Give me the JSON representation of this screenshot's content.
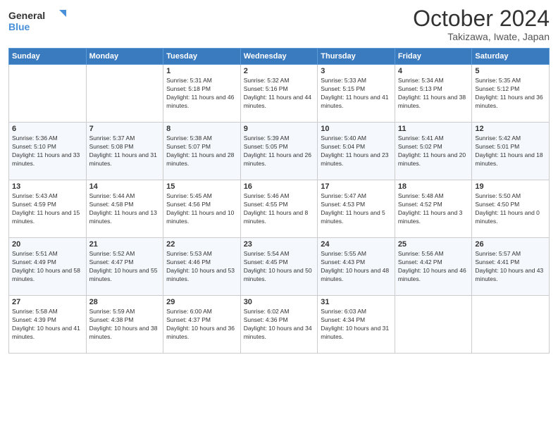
{
  "header": {
    "logo_line1": "General",
    "logo_line2": "Blue",
    "month": "October 2024",
    "location": "Takizawa, Iwate, Japan"
  },
  "weekdays": [
    "Sunday",
    "Monday",
    "Tuesday",
    "Wednesday",
    "Thursday",
    "Friday",
    "Saturday"
  ],
  "weeks": [
    [
      {
        "day": "",
        "sunrise": "",
        "sunset": "",
        "daylight": ""
      },
      {
        "day": "",
        "sunrise": "",
        "sunset": "",
        "daylight": ""
      },
      {
        "day": "1",
        "sunrise": "Sunrise: 5:31 AM",
        "sunset": "Sunset: 5:18 PM",
        "daylight": "Daylight: 11 hours and 46 minutes."
      },
      {
        "day": "2",
        "sunrise": "Sunrise: 5:32 AM",
        "sunset": "Sunset: 5:16 PM",
        "daylight": "Daylight: 11 hours and 44 minutes."
      },
      {
        "day": "3",
        "sunrise": "Sunrise: 5:33 AM",
        "sunset": "Sunset: 5:15 PM",
        "daylight": "Daylight: 11 hours and 41 minutes."
      },
      {
        "day": "4",
        "sunrise": "Sunrise: 5:34 AM",
        "sunset": "Sunset: 5:13 PM",
        "daylight": "Daylight: 11 hours and 38 minutes."
      },
      {
        "day": "5",
        "sunrise": "Sunrise: 5:35 AM",
        "sunset": "Sunset: 5:12 PM",
        "daylight": "Daylight: 11 hours and 36 minutes."
      }
    ],
    [
      {
        "day": "6",
        "sunrise": "Sunrise: 5:36 AM",
        "sunset": "Sunset: 5:10 PM",
        "daylight": "Daylight: 11 hours and 33 minutes."
      },
      {
        "day": "7",
        "sunrise": "Sunrise: 5:37 AM",
        "sunset": "Sunset: 5:08 PM",
        "daylight": "Daylight: 11 hours and 31 minutes."
      },
      {
        "day": "8",
        "sunrise": "Sunrise: 5:38 AM",
        "sunset": "Sunset: 5:07 PM",
        "daylight": "Daylight: 11 hours and 28 minutes."
      },
      {
        "day": "9",
        "sunrise": "Sunrise: 5:39 AM",
        "sunset": "Sunset: 5:05 PM",
        "daylight": "Daylight: 11 hours and 26 minutes."
      },
      {
        "day": "10",
        "sunrise": "Sunrise: 5:40 AM",
        "sunset": "Sunset: 5:04 PM",
        "daylight": "Daylight: 11 hours and 23 minutes."
      },
      {
        "day": "11",
        "sunrise": "Sunrise: 5:41 AM",
        "sunset": "Sunset: 5:02 PM",
        "daylight": "Daylight: 11 hours and 20 minutes."
      },
      {
        "day": "12",
        "sunrise": "Sunrise: 5:42 AM",
        "sunset": "Sunset: 5:01 PM",
        "daylight": "Daylight: 11 hours and 18 minutes."
      }
    ],
    [
      {
        "day": "13",
        "sunrise": "Sunrise: 5:43 AM",
        "sunset": "Sunset: 4:59 PM",
        "daylight": "Daylight: 11 hours and 15 minutes."
      },
      {
        "day": "14",
        "sunrise": "Sunrise: 5:44 AM",
        "sunset": "Sunset: 4:58 PM",
        "daylight": "Daylight: 11 hours and 13 minutes."
      },
      {
        "day": "15",
        "sunrise": "Sunrise: 5:45 AM",
        "sunset": "Sunset: 4:56 PM",
        "daylight": "Daylight: 11 hours and 10 minutes."
      },
      {
        "day": "16",
        "sunrise": "Sunrise: 5:46 AM",
        "sunset": "Sunset: 4:55 PM",
        "daylight": "Daylight: 11 hours and 8 minutes."
      },
      {
        "day": "17",
        "sunrise": "Sunrise: 5:47 AM",
        "sunset": "Sunset: 4:53 PM",
        "daylight": "Daylight: 11 hours and 5 minutes."
      },
      {
        "day": "18",
        "sunrise": "Sunrise: 5:48 AM",
        "sunset": "Sunset: 4:52 PM",
        "daylight": "Daylight: 11 hours and 3 minutes."
      },
      {
        "day": "19",
        "sunrise": "Sunrise: 5:50 AM",
        "sunset": "Sunset: 4:50 PM",
        "daylight": "Daylight: 11 hours and 0 minutes."
      }
    ],
    [
      {
        "day": "20",
        "sunrise": "Sunrise: 5:51 AM",
        "sunset": "Sunset: 4:49 PM",
        "daylight": "Daylight: 10 hours and 58 minutes."
      },
      {
        "day": "21",
        "sunrise": "Sunrise: 5:52 AM",
        "sunset": "Sunset: 4:47 PM",
        "daylight": "Daylight: 10 hours and 55 minutes."
      },
      {
        "day": "22",
        "sunrise": "Sunrise: 5:53 AM",
        "sunset": "Sunset: 4:46 PM",
        "daylight": "Daylight: 10 hours and 53 minutes."
      },
      {
        "day": "23",
        "sunrise": "Sunrise: 5:54 AM",
        "sunset": "Sunset: 4:45 PM",
        "daylight": "Daylight: 10 hours and 50 minutes."
      },
      {
        "day": "24",
        "sunrise": "Sunrise: 5:55 AM",
        "sunset": "Sunset: 4:43 PM",
        "daylight": "Daylight: 10 hours and 48 minutes."
      },
      {
        "day": "25",
        "sunrise": "Sunrise: 5:56 AM",
        "sunset": "Sunset: 4:42 PM",
        "daylight": "Daylight: 10 hours and 46 minutes."
      },
      {
        "day": "26",
        "sunrise": "Sunrise: 5:57 AM",
        "sunset": "Sunset: 4:41 PM",
        "daylight": "Daylight: 10 hours and 43 minutes."
      }
    ],
    [
      {
        "day": "27",
        "sunrise": "Sunrise: 5:58 AM",
        "sunset": "Sunset: 4:39 PM",
        "daylight": "Daylight: 10 hours and 41 minutes."
      },
      {
        "day": "28",
        "sunrise": "Sunrise: 5:59 AM",
        "sunset": "Sunset: 4:38 PM",
        "daylight": "Daylight: 10 hours and 38 minutes."
      },
      {
        "day": "29",
        "sunrise": "Sunrise: 6:00 AM",
        "sunset": "Sunset: 4:37 PM",
        "daylight": "Daylight: 10 hours and 36 minutes."
      },
      {
        "day": "30",
        "sunrise": "Sunrise: 6:02 AM",
        "sunset": "Sunset: 4:36 PM",
        "daylight": "Daylight: 10 hours and 34 minutes."
      },
      {
        "day": "31",
        "sunrise": "Sunrise: 6:03 AM",
        "sunset": "Sunset: 4:34 PM",
        "daylight": "Daylight: 10 hours and 31 minutes."
      },
      {
        "day": "",
        "sunrise": "",
        "sunset": "",
        "daylight": ""
      },
      {
        "day": "",
        "sunrise": "",
        "sunset": "",
        "daylight": ""
      }
    ]
  ]
}
